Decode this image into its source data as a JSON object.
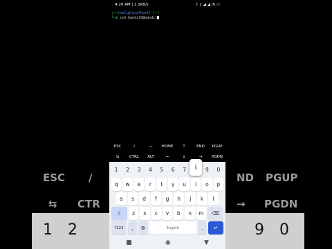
{
  "status_bar": {
    "time_info": "4:20 AM | 1.1KB/s",
    "icons": [
      "bluetooth-icon",
      "vibrate-icon",
      "signal-icon",
      "signal-icon",
      "wifi-icon",
      "battery-icon"
    ]
  },
  "terminal": {
    "line1_prefix": "┌──(",
    "line1_user": "kali@localhost",
    "line1_suffix": ")-[~]",
    "line2_prompt": "└─$ ",
    "line2_cmd": "ssh bandit0@bandit"
  },
  "extra_keys": {
    "row1": [
      "ESC",
      "/",
      "—",
      "HOME",
      "↑",
      "END",
      "PGUP"
    ],
    "row2": [
      "⇆",
      "CTRL",
      "ALT",
      "←",
      "↓",
      "→",
      "PGDN"
    ]
  },
  "keyboard": {
    "numbers": [
      "1",
      "2",
      "3",
      "4",
      "5",
      "6",
      "7",
      "8",
      "9",
      "0"
    ],
    "row1": [
      "q",
      "w",
      "e",
      "r",
      "t",
      "y",
      "u",
      "i",
      "o",
      "p"
    ],
    "row2": [
      "a",
      "s",
      "d",
      "f",
      "g",
      "h",
      "j",
      "k",
      "l"
    ],
    "row3": [
      "z",
      "x",
      "c",
      "v",
      "b",
      "n",
      "m"
    ],
    "symbols_label": "?123",
    "comma": ",",
    "space_label": "English",
    "period": ".",
    "popup_key": "i"
  },
  "background": {
    "row1": [
      "ESC",
      "/",
      "ND",
      "PGUP"
    ],
    "row2": [
      "⇆",
      "CTR",
      "→",
      "PGDN"
    ],
    "nums": [
      "1",
      "2",
      "9",
      "0"
    ]
  }
}
